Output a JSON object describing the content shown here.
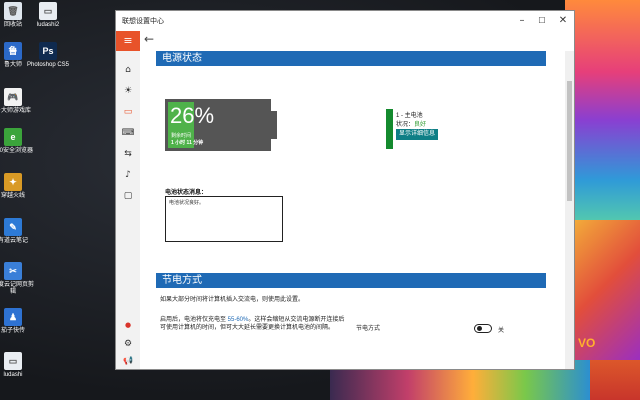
{
  "desktop": {
    "icons": [
      {
        "label": "回收站",
        "icon": "recycle-bin-icon",
        "color": "#dfe6ee",
        "glyph": "🗑"
      },
      {
        "label": "ludashi2",
        "icon": "folder-icon",
        "color": "#e9edf2",
        "glyph": "▭"
      },
      {
        "label": "鲁大师",
        "icon": "ludashi-icon",
        "color": "#2b69c8",
        "glyph": "鲁"
      },
      {
        "label": "Photoshop CS5",
        "icon": "photoshop-icon",
        "color": "#0f2a4f",
        "glyph": "Ps"
      },
      {
        "label": "鲁大师游戏库",
        "icon": "gamepad-icon",
        "color": "#f2f2f2",
        "glyph": "🎮"
      },
      {
        "label": "360安全浏览器",
        "icon": "browser-360-icon",
        "color": "#3ba43b",
        "glyph": "e"
      },
      {
        "label": "穿越火线",
        "icon": "crossfire-icon",
        "color": "#d99a25",
        "glyph": "✦"
      },
      {
        "label": "有道云笔记",
        "icon": "youdao-note-icon",
        "color": "#2d7ad6",
        "glyph": "✎"
      },
      {
        "label": "百度云记网页剪辑",
        "icon": "clip-icon",
        "color": "#3a7fd8",
        "glyph": "✂"
      },
      {
        "label": "茄子快传",
        "icon": "qiezi-icon",
        "color": "#2e72d2",
        "glyph": "♟"
      },
      {
        "label": "ludashi",
        "icon": "folder-icon",
        "color": "#e9edf2",
        "glyph": "▭"
      }
    ],
    "brand": "VO"
  },
  "window": {
    "title": "联想设置中心",
    "controls": {
      "minimize": "–",
      "maximize": "☐",
      "close": "✕"
    },
    "menu_glyph": "≡",
    "back_glyph": "←"
  },
  "sidebar": {
    "items": [
      {
        "name": "home-icon",
        "glyph": "⌂"
      },
      {
        "name": "brightness-icon",
        "glyph": "☀"
      },
      {
        "name": "battery-icon",
        "glyph": "▭"
      },
      {
        "name": "keyboard-icon",
        "glyph": "⌨"
      },
      {
        "name": "network-icon",
        "glyph": "⇆"
      },
      {
        "name": "audio-icon",
        "glyph": "♪"
      },
      {
        "name": "display-icon",
        "glyph": "▢"
      },
      {
        "name": "user-icon",
        "glyph": "●"
      },
      {
        "name": "settings-icon",
        "glyph": "⚙"
      },
      {
        "name": "announce-icon",
        "glyph": "📢"
      }
    ]
  },
  "power": {
    "section_title": "电源状态",
    "battery_percent_text": "26%",
    "battery_level": 0.26,
    "remaining_label": "剩余时间",
    "remaining_value": "1 小时 11 分钟",
    "battery_name": "1 - 主电池",
    "state_label": "状况：",
    "state_value": "良好",
    "detail_button": "显示详细信息",
    "status_msg_label": "电池状态消息：",
    "status_msg_text": "电池状况良好。"
  },
  "saving": {
    "section_title": "节电方式",
    "intro": "如果大部分时间将计算机插入交流电，则使用此设置。",
    "desc_part1": "启用后，电池将仅充电至 ",
    "desc_range": "55-60%",
    "desc_part2": "。这样会缩短从交流电源断开连接后可使用计算机的时间，但可大大延长需要更换计算机电池的间隔。",
    "setting_label": "节电方式",
    "toggle_state": "关"
  },
  "colors": {
    "accent": "#1f6ab5",
    "menu": "#e8532a",
    "battery_fill": "#4fb24a",
    "good": "#2b9a2b"
  }
}
